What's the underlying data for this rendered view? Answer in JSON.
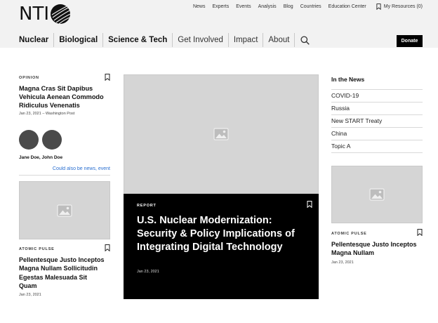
{
  "brand": {
    "logo_text": "NTI"
  },
  "utility_nav": {
    "items": [
      "News",
      "Experts",
      "Events",
      "Analysis",
      "Blog",
      "Countries",
      "Education Center"
    ],
    "my_resources": "My Resources (0)"
  },
  "main_nav": {
    "items": [
      "Nuclear",
      "Biological",
      "Science & Tech",
      "Get Involved",
      "Impact",
      "About"
    ],
    "donate": "Donate"
  },
  "left_column": {
    "opinion": {
      "kicker": "OPINION",
      "title": "Magna Cras Sit Dapibus Vehicula Aenean Commodo Ridiculus Venenatis",
      "meta": "Jan 23, 2021 – Washington Post",
      "authors": "Jane Doe, John Doe",
      "link": "Could also be news, event"
    },
    "atomic": {
      "kicker": "ATOMIC PULSE",
      "title": "Pellentesque Justo Inceptos Magna Nullam Sollicitudin Egestas Malesuada Sit Quam",
      "date": "Jan 23, 2021"
    }
  },
  "feature": {
    "kicker": "REPORT",
    "title": "U.S. Nuclear Modernization: Security & Policy Implications of Integrating Digital Technology",
    "date": "Jan 23, 2021"
  },
  "right_column": {
    "in_the_news": {
      "title": "In the News",
      "items": [
        "COVID-19",
        "Russia",
        "New START Treaty",
        "China",
        "Topic A"
      ]
    },
    "atomic": {
      "kicker": "ATOMIC PULSE",
      "title": "Pellentesque Justo Inceptos Magna Nullam",
      "date": "Jan 23, 2021"
    }
  },
  "colors": {
    "header_bg": "#f2f2f2",
    "feature_bg": "#000000",
    "link": "#2a6fd0",
    "placeholder": "#d5d5d5"
  }
}
